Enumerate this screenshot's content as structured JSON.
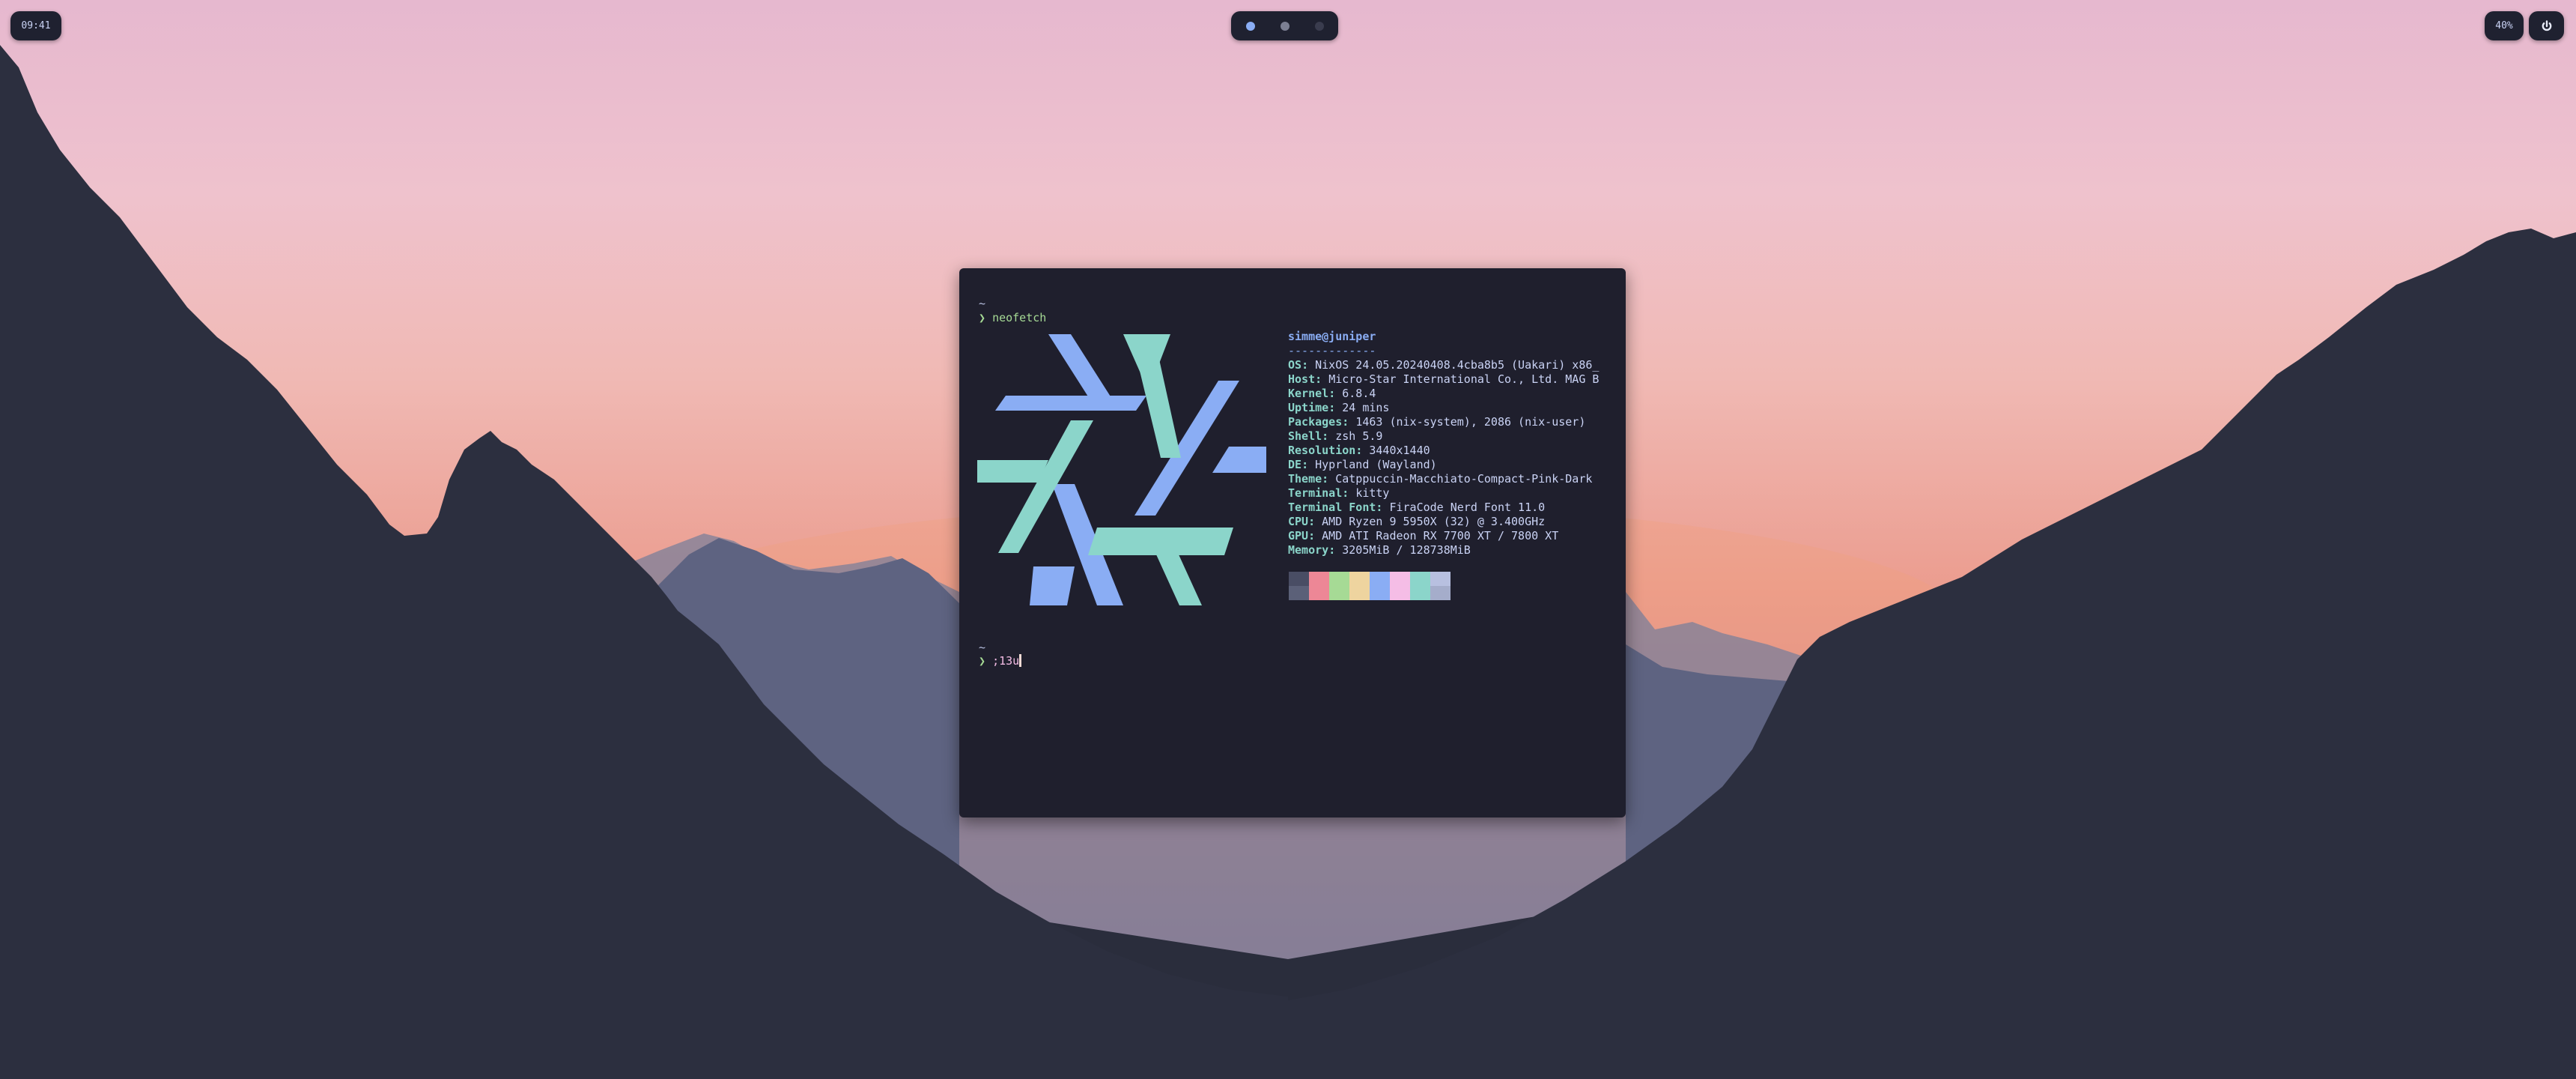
{
  "topbar": {
    "clock": "09:41",
    "workspaces": [
      {
        "state": "active",
        "color": "#8aadf4"
      },
      {
        "state": "occupied",
        "color": "#7c7f93"
      },
      {
        "state": "empty",
        "color": "#3a3c4e"
      }
    ],
    "battery": "40%",
    "power_icon": "power-icon"
  },
  "terminal": {
    "lines": {
      "tilde1": "~",
      "prompt1": "❯",
      "command1": "neofetch",
      "tilde2": "~",
      "prompt2": "❯",
      "command2": ";13u"
    },
    "logo_colors": [
      "#8aadf4",
      "#8bd5ca"
    ],
    "info": {
      "title": "simme@juniper",
      "separator": "-------------",
      "rows": [
        {
          "key": "OS",
          "value": "NixOS 24.05.20240408.4cba8b5 (Uakari) x86_"
        },
        {
          "key": "Host",
          "value": "Micro-Star International Co., Ltd. MAG B"
        },
        {
          "key": "Kernel",
          "value": "6.8.4"
        },
        {
          "key": "Uptime",
          "value": "24 mins"
        },
        {
          "key": "Packages",
          "value": "1463 (nix-system), 2086 (nix-user)"
        },
        {
          "key": "Shell",
          "value": "zsh 5.9"
        },
        {
          "key": "Resolution",
          "value": "3440x1440"
        },
        {
          "key": "DE",
          "value": "Hyprland (Wayland)"
        },
        {
          "key": "Theme",
          "value": "Catppuccin-Macchiato-Compact-Pink-Dark"
        },
        {
          "key": "Terminal",
          "value": "kitty"
        },
        {
          "key": "Terminal Font",
          "value": "FiraCode Nerd Font 11.0"
        },
        {
          "key": "CPU",
          "value": "AMD Ryzen 9 5950X (32) @ 3.400GHz"
        },
        {
          "key": "GPU",
          "value": "AMD ATI Radeon RX 7700 XT / 7800 XT"
        },
        {
          "key": "Memory",
          "value": "3205MiB / 128738MiB"
        }
      ],
      "palette": [
        "#494d64",
        "#ed8796",
        "#a6da95",
        "#eed49f",
        "#8aadf4",
        "#f5bde6",
        "#8bd5ca",
        "#b8c0e0",
        "#5b6078",
        "#ed8796",
        "#a6da95",
        "#eed49f",
        "#8aadf4",
        "#f5bde6",
        "#8bd5ca",
        "#a5adcb"
      ]
    }
  }
}
